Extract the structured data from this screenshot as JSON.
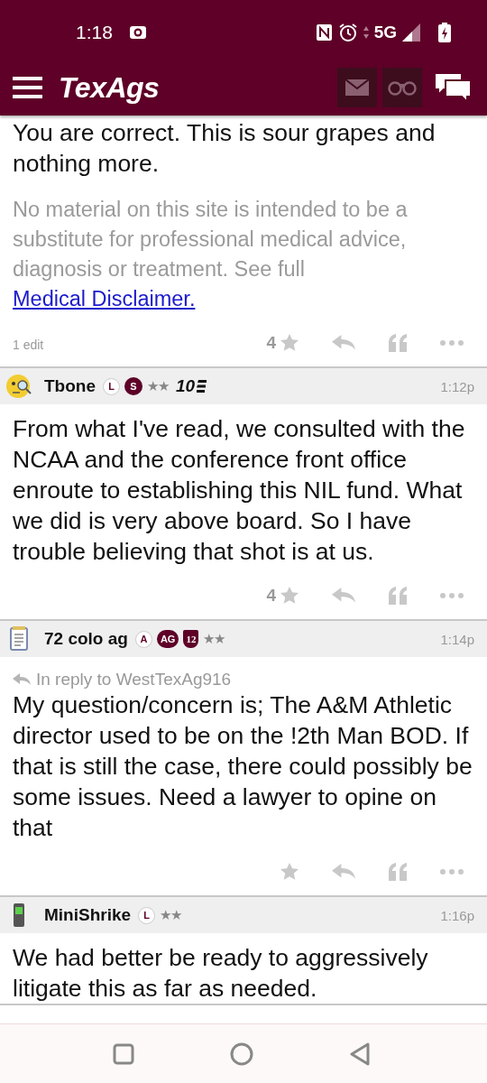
{
  "status_bar": {
    "time": "1:18",
    "network": "5G"
  },
  "app_bar": {
    "logo": "TexAgs"
  },
  "posts": [
    {
      "body": "You are correct. This is sour grapes and nothing more.",
      "disclaimer": {
        "text": "No material on this site is intended to be a substitute for professional medical advice, diagnosis or treatment. See full ",
        "link": "Medical Disclaimer."
      },
      "edits": "1 edit",
      "star_count": "4",
      "actions": true
    },
    {
      "author": {
        "name": "Tbone",
        "kind": "emoji",
        "badges": [
          {
            "kind": "outline",
            "text": "L"
          },
          {
            "kind": "filled",
            "text": "S"
          },
          {
            "kind": "stars",
            "text": "★★"
          },
          {
            "kind": "rank",
            "text": "10"
          }
        ]
      },
      "time": "1:12p",
      "body": "From what I've read, we consulted with the NCAA and the conference front office enroute to establishing this NIL fund. What we did is very above board. So I have trouble believing that shot is at us.",
      "star_count": "4",
      "actions": true
    },
    {
      "author": {
        "name": "72 colo ag",
        "kind": "notepad",
        "badges": [
          {
            "kind": "outline",
            "text": "A"
          },
          {
            "kind": "filled",
            "text": "AG"
          },
          {
            "kind": "shield",
            "text": "12"
          },
          {
            "kind": "stars",
            "text": "★★"
          }
        ]
      },
      "time": "1:14p",
      "reply_to": "In reply to WestTexAg916",
      "body": "My question/concern is; The A&M Athletic director used to be on the !2th Man BOD. If that is still the case, there could possibly be some issues. Need a lawyer to opine on that",
      "actions": true
    },
    {
      "author": {
        "name": "MiniShrike",
        "kind": "phone",
        "badges": [
          {
            "kind": "outline",
            "text": "L"
          },
          {
            "kind": "stars",
            "text": "★★"
          }
        ]
      },
      "time": "1:16p",
      "body": "We had better be ready to aggressively litigate this as far as needed."
    }
  ]
}
